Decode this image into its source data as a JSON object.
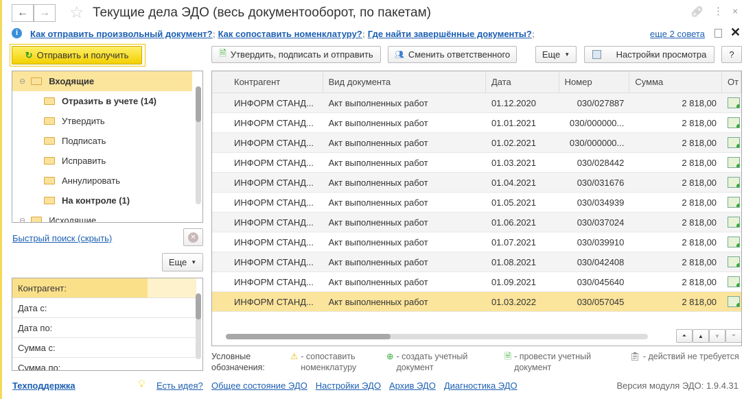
{
  "header": {
    "title": "Текущие дела ЭДО (весь документооборот, по пакетам)"
  },
  "tips": {
    "links": [
      "Как отправить произвольный документ?",
      "Как сопоставить номенклатуру?",
      "Где найти завершённые документы?"
    ],
    "more": "еще 2 совета"
  },
  "toolbar": {
    "send_receive": "Отправить и получить",
    "approve_sign_send": "Утвердить, подписать и отправить",
    "change_responsible": "Сменить ответственного",
    "more": "Еще",
    "view_settings": "Настройки просмотра",
    "help": "?"
  },
  "tree": {
    "items": [
      {
        "label": "Входящие",
        "bold": true,
        "level": 0
      },
      {
        "label": "Отразить в учете (14)",
        "bold": true,
        "level": 1
      },
      {
        "label": "Утвердить",
        "level": 1
      },
      {
        "label": "Подписать",
        "level": 1
      },
      {
        "label": "Исправить",
        "level": 1
      },
      {
        "label": "Аннулировать",
        "level": 1
      },
      {
        "label": "На контроле (1)",
        "bold": true,
        "level": 1
      },
      {
        "label": "Исходящие",
        "level": 0
      }
    ]
  },
  "quick_search": {
    "label": "Быстрый поиск (скрыть)",
    "more": "Еще"
  },
  "filters": [
    "Контрагент:",
    "Дата с:",
    "Дата по:",
    "Сумма с:",
    "Сумма по:"
  ],
  "grid": {
    "columns": [
      "Контрагент",
      "Вид документа",
      "Дата",
      "Номер",
      "Сумма",
      "От"
    ],
    "rows": [
      [
        "ИНФОРМ СТАНД...",
        "Акт выполненных работ",
        "01.12.2020",
        "030/027887",
        "2 818,00"
      ],
      [
        "ИНФОРМ СТАНД...",
        "Акт выполненных работ",
        "01.01.2021",
        "030/000000...",
        "2 818,00"
      ],
      [
        "ИНФОРМ СТАНД...",
        "Акт выполненных работ",
        "01.02.2021",
        "030/000000...",
        "2 818,00"
      ],
      [
        "ИНФОРМ СТАНД...",
        "Акт выполненных работ",
        "01.03.2021",
        "030/028442",
        "2 818,00"
      ],
      [
        "ИНФОРМ СТАНД...",
        "Акт выполненных работ",
        "01.04.2021",
        "030/031676",
        "2 818,00"
      ],
      [
        "ИНФОРМ СТАНД...",
        "Акт выполненных работ",
        "01.05.2021",
        "030/034939",
        "2 818,00"
      ],
      [
        "ИНФОРМ СТАНД...",
        "Акт выполненных работ",
        "01.06.2021",
        "030/037024",
        "2 818,00"
      ],
      [
        "ИНФОРМ СТАНД...",
        "Акт выполненных работ",
        "01.07.2021",
        "030/039910",
        "2 818,00"
      ],
      [
        "ИНФОРМ СТАНД...",
        "Акт выполненных работ",
        "01.08.2021",
        "030/042408",
        "2 818,00"
      ],
      [
        "ИНФОРМ СТАНД...",
        "Акт выполненных работ",
        "01.09.2021",
        "030/045640",
        "2 818,00"
      ],
      [
        "ИНФОРМ СТАНД...",
        "Акт выполненных работ",
        "01.03.2022",
        "030/057045",
        "2 818,00"
      ]
    ],
    "selected_row": 10
  },
  "legend": {
    "title": "Условные обозначения:",
    "items": [
      "- сопоставить номенклатуру",
      "- создать учетный документ",
      "- провести учетный документ",
      "- действий не требуется"
    ]
  },
  "footer": {
    "support": "Техподдержка",
    "idea": "Есть идея?",
    "links": [
      "Общее состояние ЭДО",
      "Настройки ЭДО",
      "Архив ЭДО",
      "Диагностика ЭДО"
    ],
    "version": "Версия модуля ЭДО: 1.9.4.31"
  },
  "colors": {
    "accent": "#f5d200",
    "selection": "#fbe49b",
    "link": "#1c5fb3"
  }
}
